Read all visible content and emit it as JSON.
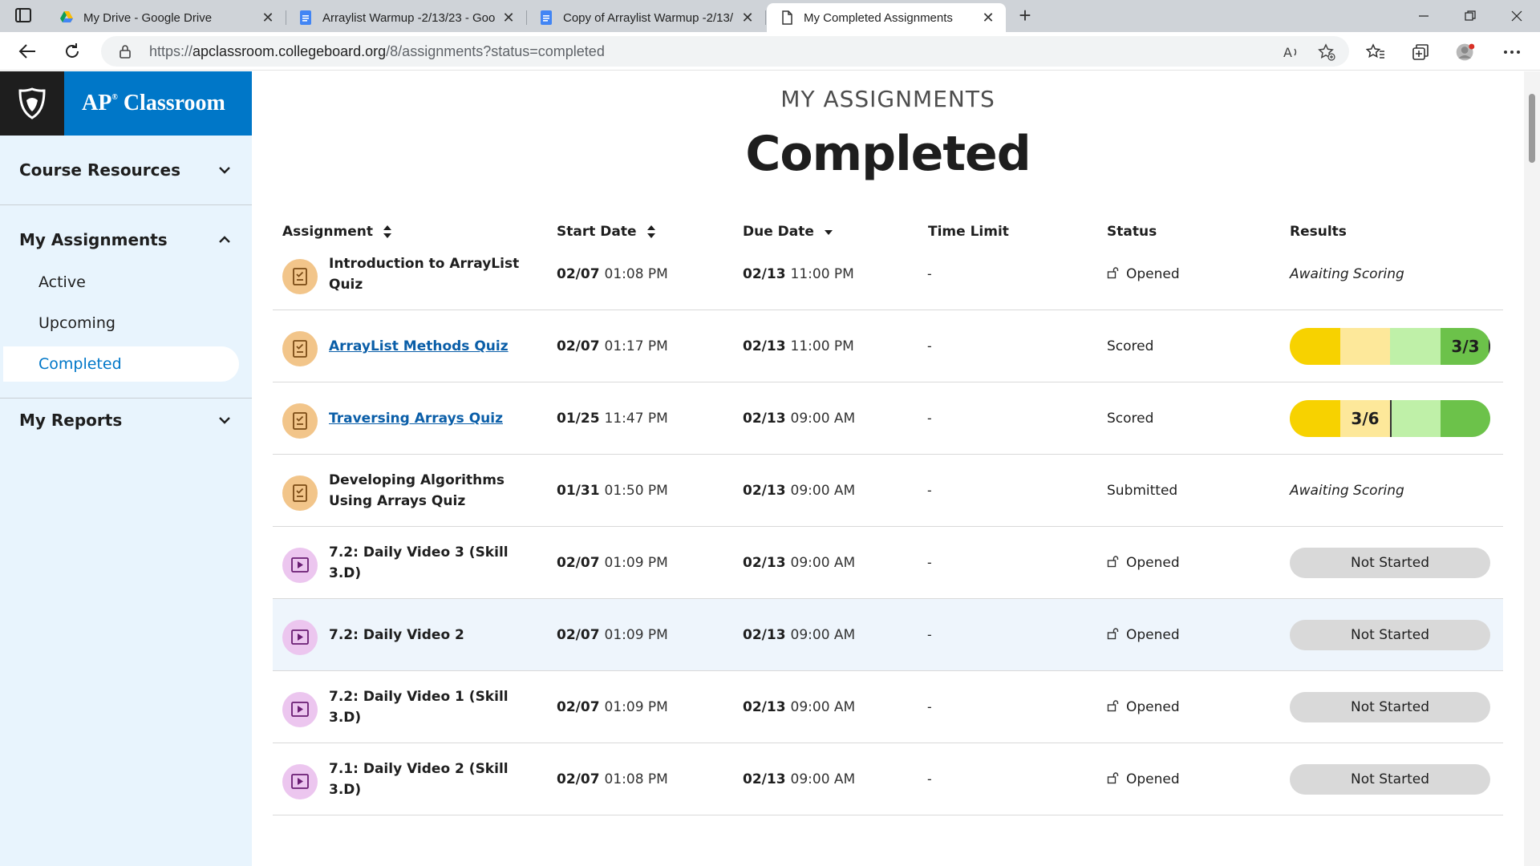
{
  "browser": {
    "tabs": [
      {
        "title": "My Drive - Google Drive",
        "icon": "google-drive-icon"
      },
      {
        "title": "Arraylist Warmup -2/13/23 - Goo",
        "icon": "google-docs-icon"
      },
      {
        "title": "Copy of Arraylist Warmup -2/13/",
        "icon": "google-docs-icon"
      },
      {
        "title": "My Completed Assignments",
        "icon": "page-icon"
      }
    ],
    "url_prefix": "https://",
    "url_host": "apclassroom.collegeboard.org",
    "url_path": "/8/assignments?status=completed"
  },
  "sidebar": {
    "brand": "AP",
    "brand_reg": "®",
    "brand_name": "Classroom",
    "course_resources": "Course Resources",
    "my_assignments": "My Assignments",
    "sub_items": [
      "Active",
      "Upcoming",
      "Completed"
    ],
    "my_reports": "My Reports"
  },
  "page": {
    "eyebrow": "MY ASSIGNMENTS",
    "title": "Completed"
  },
  "table": {
    "headers": {
      "assignment": "Assignment",
      "start_date": "Start Date",
      "due_date": "Due Date",
      "time_limit": "Time Limit",
      "status": "Status",
      "results": "Results"
    },
    "rows": [
      {
        "type": "quiz",
        "name": "Introduction to ArrayList Quiz",
        "start_day": "02/07",
        "start_time": "01:08 PM",
        "due_day": "02/13",
        "due_time": "11:00 PM",
        "time_limit": "-",
        "status": "Opened",
        "result": "Awaiting Scoring"
      },
      {
        "type": "quiz",
        "name": "ArrayList Methods Quiz",
        "link": true,
        "start_day": "02/07",
        "start_time": "01:17 PM",
        "due_day": "02/13",
        "due_time": "11:00 PM",
        "time_limit": "-",
        "status": "Scored",
        "score": "3/3",
        "score_fraction": 1.0
      },
      {
        "type": "quiz",
        "name": "Traversing Arrays Quiz",
        "link": true,
        "start_day": "01/25",
        "start_time": "11:47 PM",
        "due_day": "02/13",
        "due_time": "09:00 AM",
        "time_limit": "-",
        "status": "Scored",
        "score": "3/6",
        "score_fraction": 0.5
      },
      {
        "type": "quiz",
        "name": "Developing Algorithms Using Arrays Quiz",
        "start_day": "01/31",
        "start_time": "01:50 PM",
        "due_day": "02/13",
        "due_time": "09:00 AM",
        "time_limit": "-",
        "status": "Submitted",
        "result": "Awaiting Scoring"
      },
      {
        "type": "video",
        "name": "7.2: Daily Video 3 (Skill 3.D)",
        "start_day": "02/07",
        "start_time": "01:09 PM",
        "due_day": "02/13",
        "due_time": "09:00 AM",
        "time_limit": "-",
        "status": "Opened",
        "result": "Not Started"
      },
      {
        "type": "video",
        "name": "7.2: Daily Video 2",
        "start_day": "02/07",
        "start_time": "01:09 PM",
        "due_day": "02/13",
        "due_time": "09:00 AM",
        "time_limit": "-",
        "status": "Opened",
        "result": "Not Started"
      },
      {
        "type": "video",
        "name": "7.2: Daily Video 1 (Skill 3.D)",
        "start_day": "02/07",
        "start_time": "01:09 PM",
        "due_day": "02/13",
        "due_time": "09:00 AM",
        "time_limit": "-",
        "status": "Opened",
        "result": "Not Started"
      },
      {
        "type": "video",
        "name": "7.1: Daily Video 2 (Skill 3.D)",
        "start_day": "02/07",
        "start_time": "01:08 PM",
        "due_day": "02/13",
        "due_time": "09:00 AM",
        "time_limit": "-",
        "status": "Opened",
        "result": "Not Started"
      }
    ]
  },
  "colors": {
    "brand_blue": "#0077c8",
    "link_blue": "#0a5ea8",
    "score_yellow": "#f7d200",
    "score_light_yellow": "#fde89a",
    "score_light_green": "#bff0a8",
    "score_green": "#6cc24a"
  }
}
